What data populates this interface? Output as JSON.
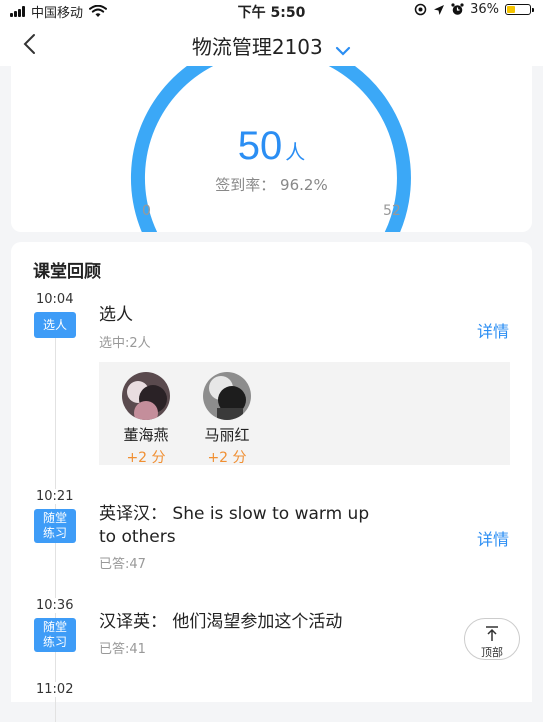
{
  "status_bar": {
    "carrier": "中国移动",
    "time": "下午 5:50",
    "battery": "36%",
    "battery_level": 0.36
  },
  "nav": {
    "title": "物流管理2103",
    "back_icon": "chevron-left-icon",
    "dropdown_icon": "chevron-down-icon"
  },
  "gauge": {
    "count": "50",
    "unit": "人",
    "rate_text": "签到率：  96.2%",
    "rate_value": 0.962,
    "min": "0",
    "max": "52",
    "color": "#3ba8f7"
  },
  "review": {
    "title": "课堂回顾",
    "entries": [
      {
        "time": "10:04",
        "tag": "选人",
        "title": "选人",
        "sub": "选中:2人",
        "link": "详情",
        "people": [
          {
            "name": "董海燕",
            "points": "+2 分"
          },
          {
            "name": "马丽红",
            "points": "+2 分"
          }
        ]
      },
      {
        "time": "10:21",
        "tag_line1": "随堂",
        "tag_line2": "练习",
        "title_line1": "英译汉：  She is slow to warm up",
        "title_line2": "to others",
        "sub": "已答:47",
        "link": "详情"
      },
      {
        "time": "10:36",
        "tag_line1": "随堂",
        "tag_line2": "练习",
        "title": "汉译英：  他们渴望参加这个活动",
        "sub": "已答:41"
      },
      {
        "time": "11:02"
      }
    ]
  },
  "top_button": {
    "label": "顶部",
    "icon": "arrow-up-icon"
  },
  "colors": {
    "accent": "#2b8ef3",
    "tag": "#3e9cf7",
    "points": "#f08f32"
  }
}
